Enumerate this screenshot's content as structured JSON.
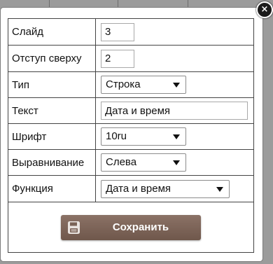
{
  "colors": {
    "button_bg": "#7a6256",
    "button_text": "#ffffff",
    "border": "#444444"
  },
  "dialog": {
    "close_icon": "×",
    "rows": [
      {
        "label": "Слайд",
        "value": "3"
      },
      {
        "label": "Отступ сверху",
        "value": "2"
      },
      {
        "label": "Тип",
        "value": "Строка"
      },
      {
        "label": "Текст",
        "value": "Дата и время"
      },
      {
        "label": "Шрифт",
        "value": "10ru"
      },
      {
        "label": "Выравнивание",
        "value": "Слева"
      },
      {
        "label": "Функция",
        "value": "Дата и время"
      }
    ],
    "save_label": "Сохранить"
  },
  "icons": {
    "close": "close-icon",
    "save": "save-icon",
    "dropdown": "chevron-down-icon"
  }
}
